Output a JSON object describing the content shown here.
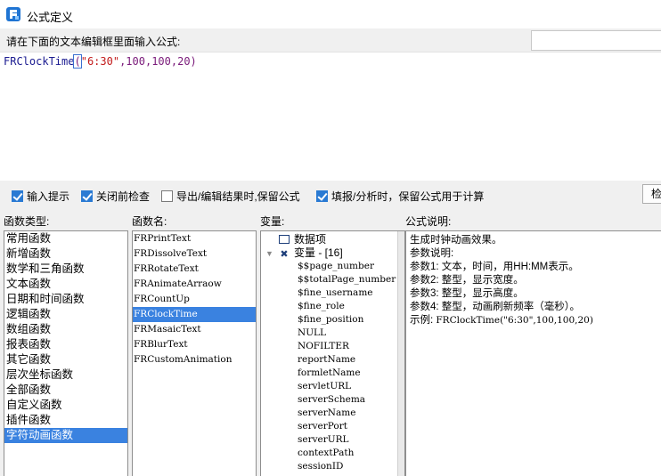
{
  "window": {
    "title": "公式定义"
  },
  "prompt": "请在下面的文本编辑框里面输入公式:",
  "formula": {
    "fn": "FRClockTime",
    "open": "(",
    "str": "\"6:30\"",
    "rest": ",100,100,20)"
  },
  "options": [
    {
      "label": "输入提示",
      "checked": true
    },
    {
      "label": "关闭前检查",
      "checked": true
    },
    {
      "label": "导出/编辑结果时,保留公式",
      "checked": false
    },
    {
      "label": "填报/分析时，保留公式用于计算",
      "checked": true
    }
  ],
  "check_button": "检",
  "headers": {
    "types": "函数类型:",
    "names": "函数名:",
    "vars": "变量:",
    "desc": "公式说明:"
  },
  "categories": [
    "常用函数",
    "新增函数",
    "数学和三角函数",
    "文本函数",
    "日期和时间函数",
    "逻辑函数",
    "数组函数",
    "报表函数",
    "其它函数",
    "层次坐标函数",
    "全部函数",
    "自定义函数",
    "插件函数",
    "字符动画函数"
  ],
  "selected_category": "字符动画函数",
  "functions": [
    "FRPrintText",
    "FRDissolveText",
    "FRRotateText",
    "FRAnimateArraow",
    "FRCountUp",
    "FRClockTime",
    "FRMasaicText",
    "FRBlurText",
    "FRCustomAnimation"
  ],
  "selected_function": "FRClockTime",
  "variables": {
    "data_item": "数据项",
    "var_group": "变量 - [16]",
    "items": [
      "$$page_number",
      "$$totalPage_number",
      "$fine_username",
      "$fine_role",
      "$fine_position",
      "NULL",
      "NOFILTER",
      "reportName",
      "formletName",
      "servletURL",
      "serverSchema",
      "serverName",
      "serverPort",
      "serverURL",
      "contextPath",
      "sessionID"
    ]
  },
  "description": [
    {
      "text": "生成时钟动画效果。",
      "mono": false
    },
    {
      "text": "参数说明:",
      "mono": false
    },
    {
      "text": "参数1: 文本，时间，用HH:MM表示。",
      "mono": false
    },
    {
      "text": "参数2: 整型，显示宽度。",
      "mono": false
    },
    {
      "text": "参数3: 整型，显示高度。",
      "mono": false
    },
    {
      "text": "参数4: 整型，动画刷新频率（毫秒）。",
      "mono": false
    },
    {
      "label": "示例: ",
      "code": "FRClockTime(\"6:30\",100,100,20)"
    }
  ],
  "icons": {
    "app": "fine-report-logo-icon",
    "data_item": "table-icon",
    "var_group": "variable-icon"
  }
}
